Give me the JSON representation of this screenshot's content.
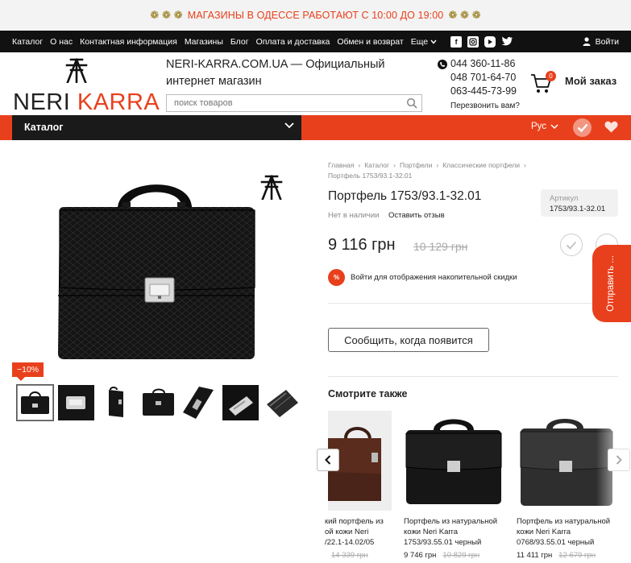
{
  "banner": {
    "text": "МАГАЗИНЫ В ОДЕССЕ РАБОТАЮТ С 10:00 ДО 19:00",
    "flowers_left": "❁ ❁ ❁",
    "flowers_right": "❁ ❁ ❁"
  },
  "nav": {
    "items": [
      "Каталог",
      "О нас",
      "Контактная информация",
      "Магазины",
      "Блог",
      "Оплата и доставка",
      "Обмен и возврат"
    ],
    "more": "Еще",
    "login": "Войти",
    "social": [
      "facebook-icon",
      "instagram-icon",
      "youtube-icon",
      "twitter-icon"
    ]
  },
  "header": {
    "logo_a": "NERI",
    "logo_b": "KARRA",
    "site_title": "NERI-KARRA.COM.UA — Официальный интернет магазин",
    "search_placeholder": "поиск товаров",
    "phones": [
      "044 360-11-86",
      "048 701-64-70",
      "063-445-73-99"
    ],
    "callback": "Перезвонить вам?",
    "cart_count": "0",
    "order_label": "Мой заказ"
  },
  "catbar": {
    "label": "Каталог",
    "lang": "Рус"
  },
  "product": {
    "breadcrumbs": [
      "Главная",
      "Каталог",
      "Портфели",
      "Классические портфели",
      "Портфель 1753/93.1-32.01"
    ],
    "title": "Портфель 1753/93.1-32.01",
    "stock": "Нет в наличии",
    "review": "Оставить отзыв",
    "sku_label": "Артикул",
    "sku": "1753/93.1-32.01",
    "price": "9 116 грн",
    "old_price": "10 129 грн",
    "discount": "−10%",
    "promo_icon": "%",
    "promo": "Войти для отображения накопительной скидки",
    "notify": "Сообщить, когда появится",
    "see_also": "Смотрите также"
  },
  "side_tab": "Отправить ...",
  "carousel": [
    {
      "name": "кий портфель из\nой кожи Neri\n/22.1-14.02/05",
      "price": "",
      "old": "14 339 грн"
    },
    {
      "name": "Портфель из натуральной\nкожи Neri Karra\n1753/93.55.01 черный",
      "price": "9 746 грн",
      "old": "10 829 грн"
    },
    {
      "name": "Портфель из натуральной\nкожи Neri Karra\n0768/93.55.01 черный",
      "price": "11 411 грн",
      "old": "12 679 грн"
    }
  ],
  "colors": {
    "accent": "#e8401c",
    "dark": "#111111"
  }
}
